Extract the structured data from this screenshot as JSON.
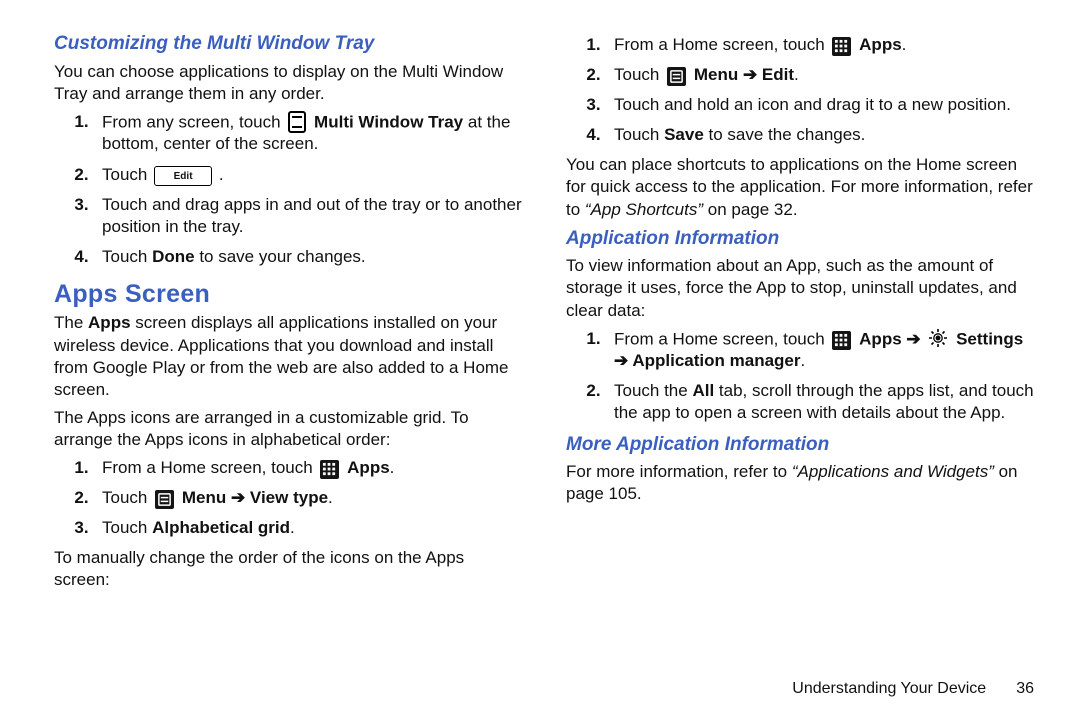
{
  "left": {
    "h_custom": "Customizing the Multi Window Tray",
    "p_custom": "You can choose applications to display on the Multi Window Tray and arrange them in any order.",
    "steps_custom": {
      "s1a": "From any screen, touch ",
      "s1b": "Multi Window Tray",
      "s1c": " at the bottom, center of the screen.",
      "s2a": "Touch ",
      "s2b_pill": "Edit",
      "s2c": " .",
      "s3": "Touch and drag apps in and out of the tray or to another position in the tray.",
      "s4a": "Touch ",
      "s4b": "Done",
      "s4c": " to save your changes."
    },
    "h_apps": "Apps Screen",
    "p_apps1a": "The ",
    "p_apps1b": "Apps",
    "p_apps1c": " screen displays all applications installed on your wireless device. Applications that you download and install from Google Play or from the web are also added to a Home screen.",
    "p_apps2": "The Apps icons are arranged in a customizable grid. To arrange the Apps icons in alphabetical order:",
    "steps_alpha": {
      "s1a": "From a Home screen, touch ",
      "s1b": "Apps",
      "s1c": ".",
      "s2a": "Touch ",
      "s2b": "Menu",
      "s2arrow": " ➔ ",
      "s2c": "View type",
      "s2d": ".",
      "s3a": "Touch ",
      "s3b": "Alphabetical grid",
      "s3c": "."
    },
    "p_manual": "To manually change the order of the icons on the Apps screen:"
  },
  "right": {
    "steps_manual": {
      "s1a": "From a Home screen, touch ",
      "s1b": "Apps",
      "s1c": ".",
      "s2a": "Touch ",
      "s2b": "Menu",
      "s2arrow": " ➔ ",
      "s2c": "Edit",
      "s2d": ".",
      "s3": "Touch and hold an icon and drag it to a new position.",
      "s4a": "Touch ",
      "s4b": "Save",
      "s4c": " to save the changes."
    },
    "p_shortcuts1": "You can place shortcuts to applications on the Home screen for quick access to the application. For more information, refer to ",
    "p_shortcuts_ref": "“App Shortcuts”",
    "p_shortcuts2": " on page 32.",
    "h_appinfo": "Application Information",
    "p_appinfo": "To view information about an App, such as the amount of storage it uses, force the App to stop, uninstall updates, and clear data:",
    "steps_info": {
      "s1a": "From a Home screen, touch ",
      "s1b": "Apps",
      "s1arrow1": " ➔ ",
      "s1c": "Settings",
      "s1arrow2": "➔ ",
      "s1d": "Application manager",
      "s1e": ".",
      "s2a": "Touch the ",
      "s2b": "All",
      "s2c": " tab, scroll through the apps list, and touch the app to open a screen with details about the App."
    },
    "h_more": "More Application Information",
    "p_more1": "For more information, refer to ",
    "p_more_ref": "“Applications and Widgets”",
    "p_more2": " on page 105."
  },
  "footer": {
    "chapter": "Understanding Your Device",
    "page": "36"
  }
}
